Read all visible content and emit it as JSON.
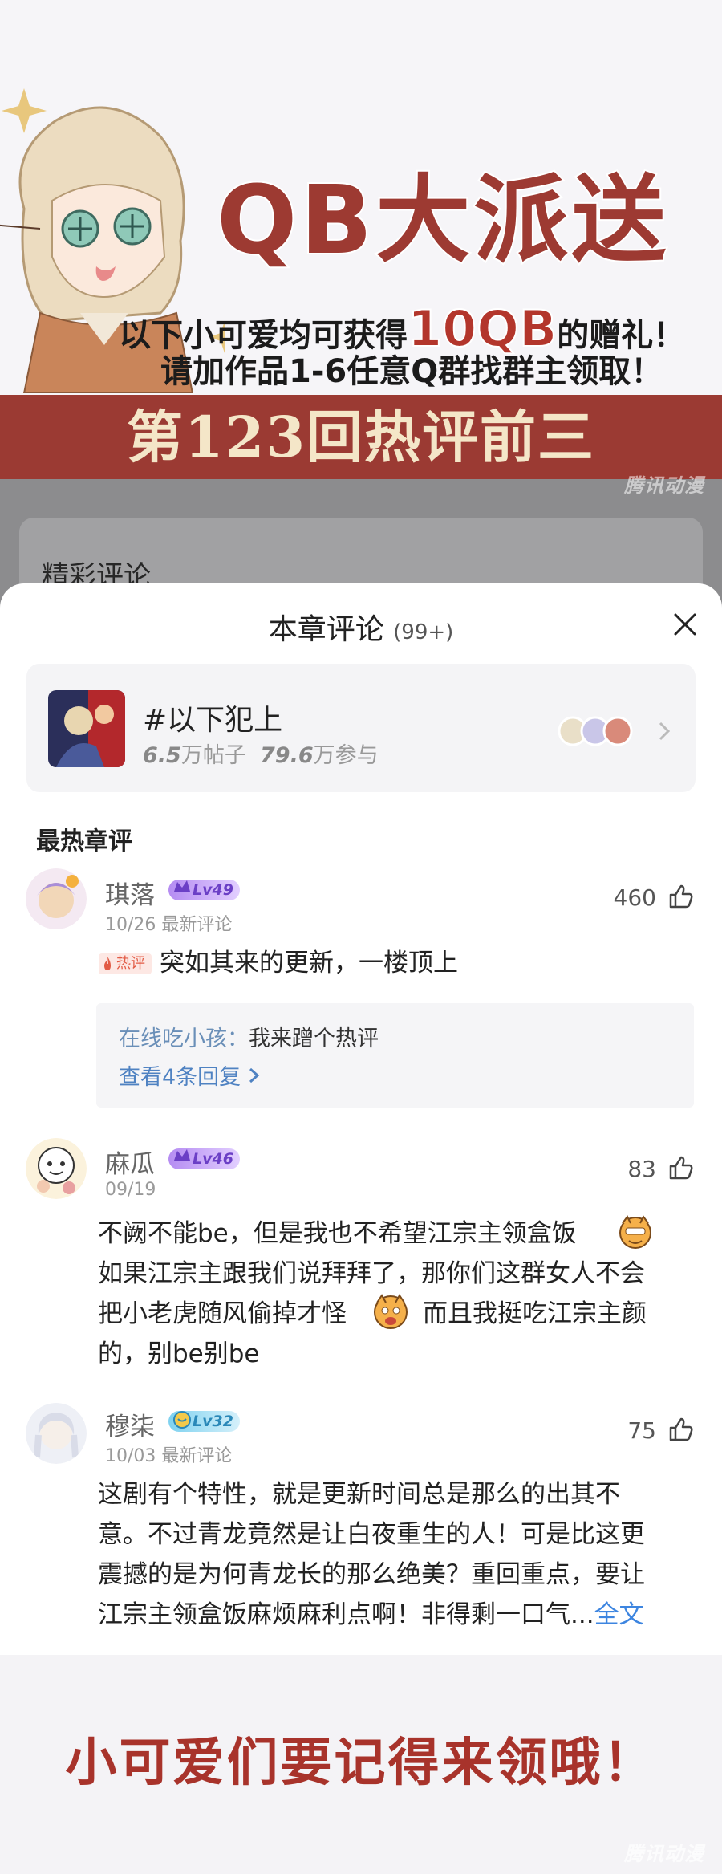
{
  "banner": {
    "headline": "QB大派送",
    "line1_prefix": "以下小可爱均可获得",
    "line1_amount": "10QB",
    "line1_suffix": "的赠礼！",
    "line2": "请加作品1-6任意Q群找群主领取！",
    "band_text": "第123回热评前三",
    "watermark": "腾讯动漫"
  },
  "background": {
    "section_title": "精彩评论"
  },
  "sheet": {
    "title": "本章评论",
    "count": "(99+)",
    "close_icon": "close-icon",
    "topic": {
      "name": "#以下犯上",
      "posts_value": "6.5",
      "posts_suffix": "万帖子",
      "participants_value": "79.6",
      "participants_suffix": "万参与"
    },
    "section_title": "最热章评"
  },
  "comments": [
    {
      "user": "琪落",
      "level": "Lv49",
      "date": "10/26",
      "tag": "最新评论",
      "likes": "460",
      "hot_badge": "热评",
      "text": "突如其来的更新，一楼顶上",
      "reply": {
        "user": "在线吃小孩：",
        "text": "我来蹭个热评",
        "more": "查看4条回复"
      }
    },
    {
      "user": "麻瓜",
      "level": "Lv46",
      "date": "09/19",
      "likes": "83",
      "lines": [
        "不阙不能be，但是我也不希望江宗主领盒饭",
        "如果江宗主跟我们说拜拜了，那你们这群女人不会",
        "把小老虎随风偷掉才怪",
        "而且我挺吃江宗主颜",
        "的，别be别be"
      ]
    },
    {
      "user": "穆柒",
      "level": "Lv32",
      "date": "10/03",
      "tag": "最新评论",
      "likes": "75",
      "lines": [
        "这剧有个特性，就是更新时间总是那么的出其不",
        "意。不过青龙竟然是让白夜重生的人！可是比这更",
        "震撼的是为何青龙长的那么绝美？重回重点，要让",
        "江宗主领盒饭麻烦麻利点啊！非得剩一口气..."
      ],
      "fulltext": "全文"
    }
  ],
  "footer": {
    "text": "小可爱们要记得来领哦！",
    "watermark": "腾讯动漫"
  }
}
